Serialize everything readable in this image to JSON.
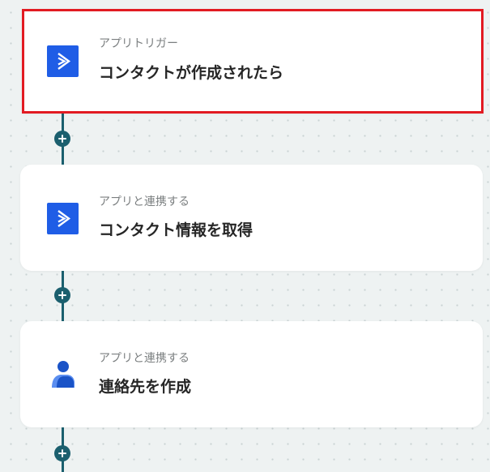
{
  "flow": {
    "steps": [
      {
        "subtitle": "アプリトリガー",
        "title": "コンタクトが作成されたら",
        "icon": "arrow-app-icon",
        "selected": true
      },
      {
        "subtitle": "アプリと連携する",
        "title": "コンタクト情報を取得",
        "icon": "arrow-app-icon"
      },
      {
        "subtitle": "アプリと連携する",
        "title": "連絡先を作成",
        "icon": "person-contact-icon"
      }
    ],
    "add_step_icon": "plus-icon"
  },
  "colors": {
    "accent_blue": "#1f5de6",
    "connector": "#1b5f6e",
    "selection_border": "#e21b22",
    "contact_blue": "#1a53c7",
    "contact_light_blue": "#5b8ef0"
  }
}
